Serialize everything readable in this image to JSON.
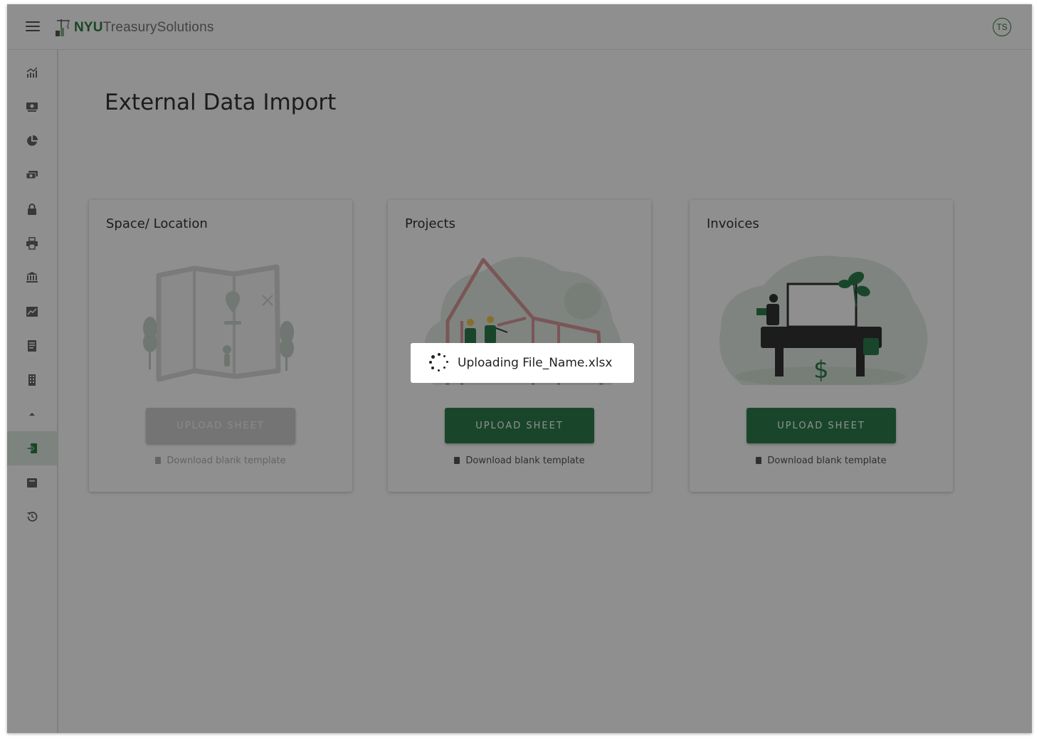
{
  "header": {
    "logo_bold": "NYU",
    "logo_rest": "TreasurySolutions",
    "avatar_initials": "TS"
  },
  "sidebar": {
    "items": [
      {
        "icon": "analytics-icon"
      },
      {
        "icon": "money-icon"
      },
      {
        "icon": "pie-chart-icon"
      },
      {
        "icon": "cash-icon"
      },
      {
        "icon": "lock-icon"
      },
      {
        "icon": "printer-icon"
      },
      {
        "icon": "bank-icon"
      },
      {
        "icon": "trending-icon"
      },
      {
        "icon": "document-icon"
      },
      {
        "icon": "building-icon"
      },
      {
        "icon": "collapse-arrow-icon"
      },
      {
        "icon": "import-icon",
        "active": true
      },
      {
        "icon": "archive-icon"
      },
      {
        "icon": "history-icon"
      }
    ]
  },
  "page": {
    "title": "External Data Import"
  },
  "cards": [
    {
      "title": "Space/ Location",
      "button": "UPLOAD SHEET",
      "link": "Download blank template",
      "disabled": true
    },
    {
      "title": "Projects",
      "button": "UPLOAD SHEET",
      "link": "Download blank template",
      "disabled": false
    },
    {
      "title": "Invoices",
      "button": "UPLOAD SHEET",
      "link": "Download blank template",
      "disabled": false
    }
  ],
  "toast": {
    "message": "Uploading File_Name.xlsx"
  },
  "colors": {
    "brand_green": "#2e7d4e",
    "overlay": "rgba(0,0,0,0.44)"
  }
}
